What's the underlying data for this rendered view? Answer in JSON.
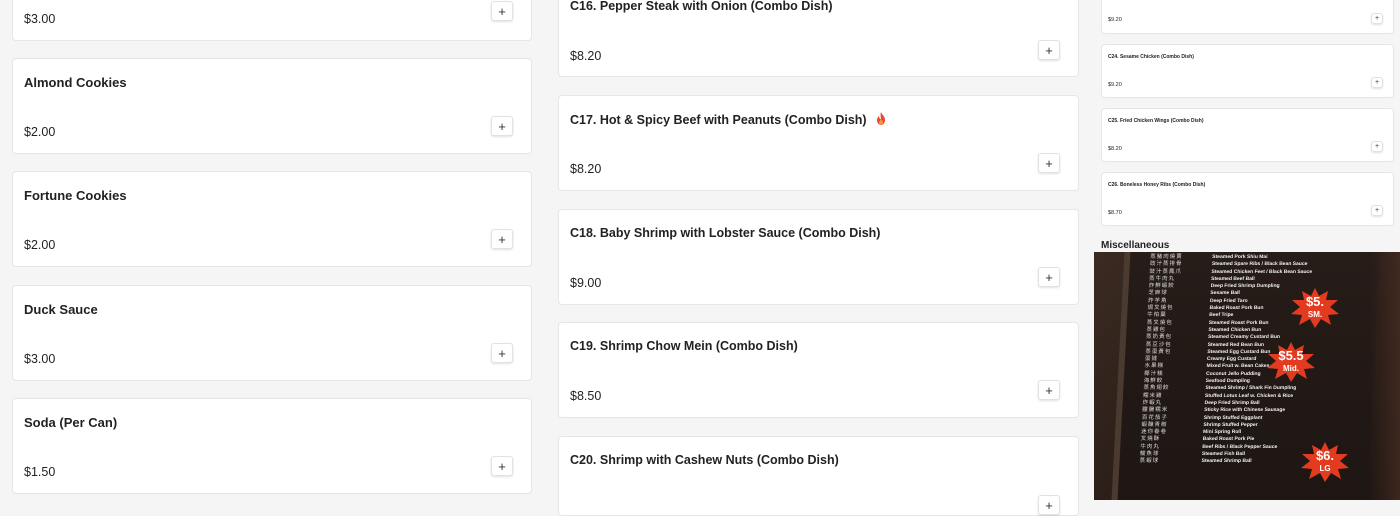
{
  "left_column": [
    {
      "title": "",
      "price": "$3.00",
      "add": "+"
    },
    {
      "title": "Almond Cookies",
      "price": "$2.00",
      "add": "+"
    },
    {
      "title": "Fortune Cookies",
      "price": "$2.00",
      "add": "+"
    },
    {
      "title": "Duck Sauce",
      "price": "$3.00",
      "add": "+"
    },
    {
      "title": "Soda (Per Can)",
      "price": "$1.50",
      "add": "+"
    }
  ],
  "middle_column": [
    {
      "title": "C16. Pepper Steak with Onion (Combo Dish)",
      "price": "$8.20",
      "add": "+"
    },
    {
      "title": "C17. Hot & Spicy Beef with Peanuts (Combo Dish)",
      "price": "$8.20",
      "add": "+",
      "spicy_icon": "flame-icon"
    },
    {
      "title": "C18. Baby Shrimp with Lobster Sauce (Combo Dish)",
      "price": "$9.00",
      "add": "+"
    },
    {
      "title": "C19. Shrimp Chow Mein (Combo Dish)",
      "price": "$8.50",
      "add": "+"
    },
    {
      "title": "C20. Shrimp with Cashew Nuts (Combo Dish)",
      "price": "",
      "add": "+"
    }
  ],
  "right_column": [
    {
      "title": "",
      "price": "$9.20",
      "add": "+"
    },
    {
      "title": "C24. Sesame Chicken (Combo Dish)",
      "price": "$9.20",
      "add": "+"
    },
    {
      "title": "C25. Fried Chicken Wings (Combo Dish)",
      "price": "$8.20",
      "add": "+"
    },
    {
      "title": "C26. Boneless Honey Ribs (Combo Dish)",
      "price": "$8.70",
      "add": "+"
    }
  ],
  "section": {
    "title": "Miscellaneous"
  },
  "photo": {
    "chinese_lines": [
      "蒸豬肉燒賣",
      "豉汁蒸排骨",
      "豉汁蒸鳳爪",
      "蒸牛肉丸",
      "炸鮮蝦餃",
      "芝麻球",
      "炸芋角",
      "焗叉燒包",
      "牛柏葉",
      "蒸叉燒包",
      "蒸雞包",
      "蒸奶黃包",
      "蒸豆沙包",
      "蒸蛋黃包",
      "蛋撻",
      "水果糕",
      "椰汁糕",
      "海鮮餃",
      "蒸魚翅餃",
      "糯米雞",
      "炸蝦丸",
      "臘腸糯米",
      "百花茄子",
      "蝦釀青椒",
      "迷你春卷",
      "叉燒酥",
      "牛肉丸",
      "鯪魚球",
      "蒸蝦球"
    ],
    "english_lines": [
      "Steamed Pork Shiu Mai",
      "Steamed Spare Ribs / Black Bean Sauce",
      "Steamed Chicken Feet / Black Bean Sauce",
      "Steamed Beef Ball",
      "Deep Fried Shrimp Dumpling",
      "Sesame Ball",
      "Deep Fried Taro",
      "Baked Roast Pork Bun",
      "Beef Tripe",
      "Steamed Roast Pork Bun",
      "Steamed Chicken Bun",
      "Steamed Creamy Custard Bun",
      "Steamed Red Bean Bun",
      "Steamed Egg Custard Bun",
      "Creamy Egg Custard",
      "Mixed Fruit w. Bean Cakes",
      "Coconut Jello Pudding",
      "Seafood Dumpling",
      "Steamed Shrimp / Shark Fin Dumpling",
      "Stuffed Lotus Leaf w. Chicken & Rice",
      "Deep Fried Shrimp Ball",
      "Sticky Rice with Chinese Sausage",
      "Shrimp Stuffed Eggplant",
      "Shrimp Stuffed Pepper",
      "Mini Spring Roll",
      "Baked Roast Pork Pie",
      "Beef Ribs / Black Pepper Sauce",
      "Steamed Fish Ball",
      "Steamed Shrimp Ball"
    ],
    "stickers": [
      {
        "value": "$5.",
        "size": "SM."
      },
      {
        "value": "$5.5",
        "size": "Mid."
      },
      {
        "value": "$6.",
        "size": "LG"
      }
    ]
  }
}
